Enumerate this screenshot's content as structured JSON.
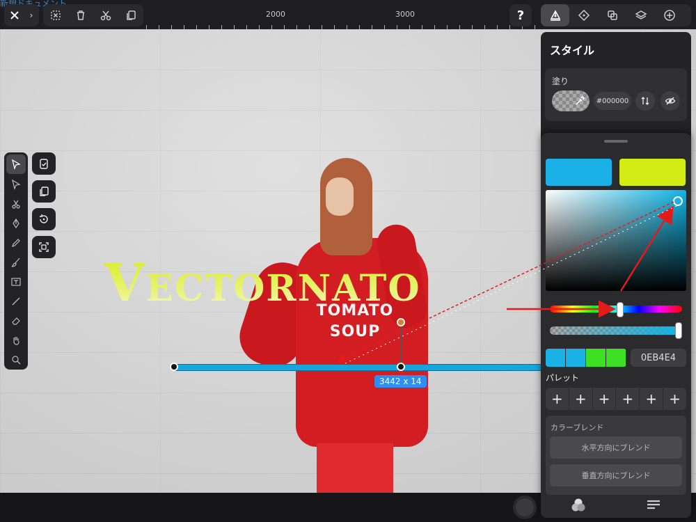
{
  "document": {
    "title": "新規ドキュメント"
  },
  "ruler": {
    "labels": [
      "2000",
      "3000"
    ]
  },
  "canvas": {
    "artwork_text": "Vectornato",
    "sweater_line1": "TOMATO",
    "sweater_line2": "SOUP",
    "selection_size": "3442 x 14"
  },
  "toolbar": {
    "close_icon": "close-icon",
    "help_label": "?"
  },
  "style_panel": {
    "title": "スタイル",
    "fill_label": "塗り",
    "fill_hex": "#000000"
  },
  "color_picker": {
    "current_color": "#1ab1e6",
    "new_color": "#d4ec16",
    "hex_value": "0EB4E4",
    "recent_colors": [
      "#1ab1e6",
      "#1ab1e6",
      "#3de025",
      "#3de025"
    ],
    "palette_label": "パレット",
    "palette_slots": [
      "+",
      "+",
      "+",
      "+",
      "+",
      "+"
    ],
    "blend_label": "カラーブレンド",
    "blend_horizontal": "水平方向にブレンド",
    "blend_vertical": "垂直方向にブレンド"
  }
}
